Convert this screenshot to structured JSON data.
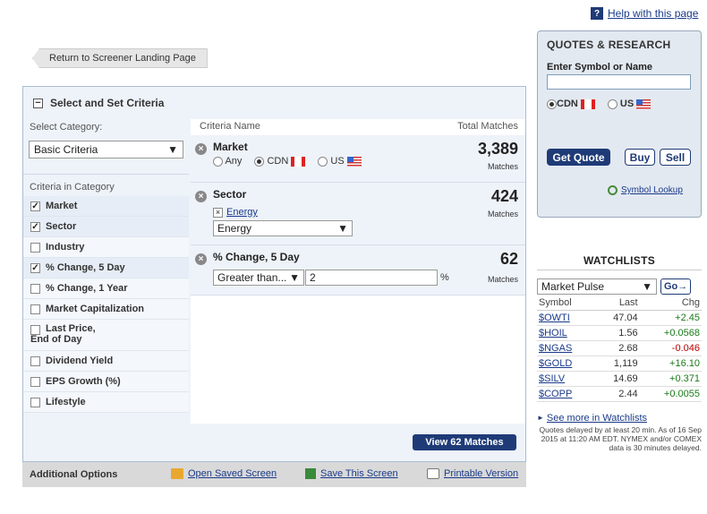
{
  "help": {
    "label": "Help with this page",
    "icon": "help-icon"
  },
  "back": {
    "label": "Return to Screener Landing Page"
  },
  "panel": {
    "title": "Select and Set Criteria",
    "select_category_label": "Select Category:",
    "category_value": "Basic Criteria",
    "criteria_in_category_label": "Criteria in Category"
  },
  "categories": [
    {
      "label": "Market",
      "checked": true
    },
    {
      "label": "Sector",
      "checked": true
    },
    {
      "label": "Industry",
      "checked": false
    },
    {
      "label": "% Change, 5 Day",
      "checked": true
    },
    {
      "label": "% Change, 1 Year",
      "checked": false
    },
    {
      "label": "Market Capitalization",
      "checked": false
    },
    {
      "label": "Last Price,",
      "label2": "End of Day",
      "checked": false
    },
    {
      "label": "Dividend Yield",
      "checked": false
    },
    {
      "label": "EPS Growth (%)",
      "checked": false
    },
    {
      "label": "Lifestyle",
      "checked": false
    }
  ],
  "criteria_header": {
    "name": "Criteria Name",
    "matches": "Total Matches"
  },
  "criteria": {
    "market": {
      "name": "Market",
      "any": "Any",
      "cdn": "CDN",
      "us": "US",
      "selected": "CDN",
      "count": "3,389",
      "matches": "Matches"
    },
    "sector": {
      "name": "Sector",
      "chip": "Energy",
      "value": "Energy",
      "count": "424",
      "matches": "Matches"
    },
    "change5": {
      "name": "% Change, 5 Day",
      "op": "Greater than...",
      "value": "2",
      "unit": "%",
      "count": "62",
      "matches": "Matches"
    }
  },
  "view_button": "View 62 Matches",
  "additional": {
    "title": "Additional Options",
    "open": "Open Saved Screen",
    "save": "Save This Screen",
    "print": "Printable Version"
  },
  "quotes": {
    "title": "QUOTES & RESEARCH",
    "input_label": "Enter Symbol or Name",
    "input_value": "",
    "cdn": "CDN",
    "us": "US",
    "selected": "CDN",
    "get_quote": "Get Quote",
    "buy": "Buy",
    "sell": "Sell",
    "symbol_lookup": "Symbol Lookup"
  },
  "watchlists": {
    "title": "WATCHLISTS",
    "list": "Market Pulse",
    "go": "Go",
    "columns": [
      "Symbol",
      "Last",
      "Chg"
    ],
    "rows": [
      {
        "sym": "$OWTI",
        "last": "47.04",
        "chg": "+2.45",
        "dir": "pos"
      },
      {
        "sym": "$HOIL",
        "last": "1.56",
        "chg": "+0.0568",
        "dir": "pos"
      },
      {
        "sym": "$NGAS",
        "last": "2.68",
        "chg": "-0.046",
        "dir": "neg"
      },
      {
        "sym": "$GOLD",
        "last": "1,119",
        "chg": "+16.10",
        "dir": "pos"
      },
      {
        "sym": "$SILV",
        "last": "14.69",
        "chg": "+0.371",
        "dir": "pos"
      },
      {
        "sym": "$COPP",
        "last": "2.44",
        "chg": "+0.0055",
        "dir": "pos"
      }
    ],
    "see_more": "See more in Watchlists",
    "note": "Quotes delayed by at least 20 min.  As of 16 Sep 2015 at 11:20 AM EDT.  NYMEX and/or COMEX data is 30 minutes delayed."
  },
  "colors": {
    "accent": "#1f3b77",
    "positive": "#1a7a1a",
    "negative": "#b00000"
  }
}
